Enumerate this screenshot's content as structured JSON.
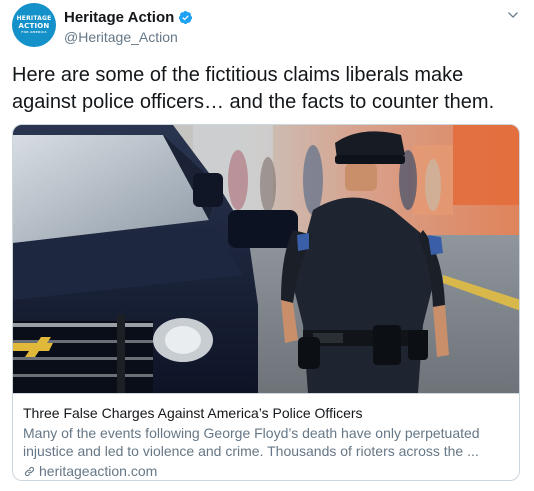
{
  "account": {
    "display_name": "Heritage Action",
    "handle": "@Heritage_Action",
    "verified": true,
    "avatar_logo_top": "HERITAGE",
    "avatar_logo_main": "ACTION",
    "avatar_logo_sub": "FOR AMERICA",
    "avatar_color": "#1591c9"
  },
  "tweet": {
    "text": "Here are some of the fictitious claims liberals make against police officers… and the facts to counter them."
  },
  "card": {
    "title": "Three False Charges Against America’s Police Officers",
    "description": "Many of the events following George Floyd’s death have only perpetuated injustice and led to violence and crime. Thousands of rioters across the ...",
    "domain": "heritageaction.com",
    "image_subject": "police-officer-walking-beside-patrol-suv"
  },
  "colors": {
    "verified_blue": "#1da1f2",
    "text_primary": "#14171a",
    "text_secondary": "#657786",
    "border": "#ccd6dd"
  },
  "icons": {
    "verified": "verified-badge-icon",
    "menu": "chevron-down-icon",
    "link": "link-icon"
  }
}
